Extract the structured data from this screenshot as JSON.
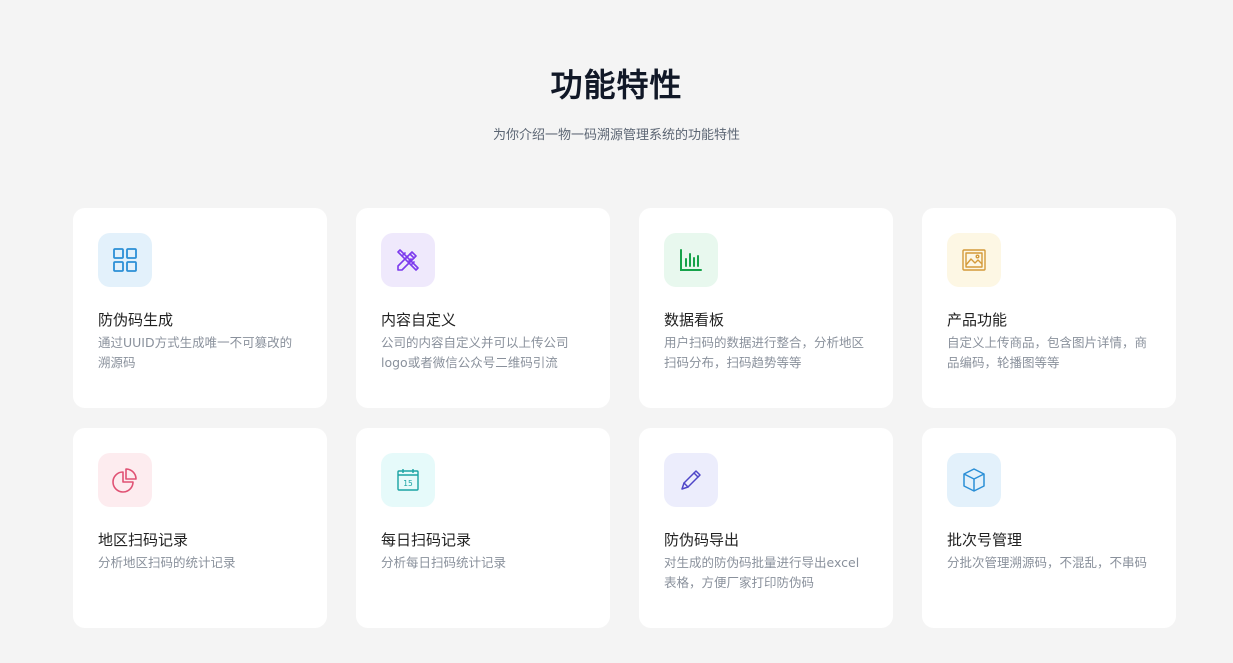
{
  "section": {
    "title": "功能特性",
    "subtitle": "为你介绍一物一码溯源管理系统的功能特性"
  },
  "features": [
    {
      "title": "防伪码生成",
      "desc": "通过UUID方式生成唯一不可篡改的溯源码",
      "icon": "grid-icon",
      "bg": "#e3f1fb",
      "color": "#2b8fd6"
    },
    {
      "title": "内容自定义",
      "desc": "公司的内容自定义并可以上传公司logo或者微信公众号二维码引流",
      "icon": "pencil-ruler-icon",
      "bg": "#efe9fc",
      "color": "#7c3aed"
    },
    {
      "title": "数据看板",
      "desc": "用户扫码的数据进行整合，分析地区扫码分布，扫码趋势等等",
      "icon": "bar-chart-icon",
      "bg": "#e8f8ee",
      "color": "#16a34a"
    },
    {
      "title": "产品功能",
      "desc": "自定义上传商品，包含图片详情，商品编码，轮播图等等",
      "icon": "image-icon",
      "bg": "#fdf7e4",
      "color": "#d49a3a"
    },
    {
      "title": "地区扫码记录",
      "desc": "分析地区扫码的统计记录",
      "icon": "pie-chart-icon",
      "bg": "#fdecef",
      "color": "#e05274"
    },
    {
      "title": "每日扫码记录",
      "desc": "分析每日扫码统计记录",
      "icon": "calendar-icon",
      "bg": "#e6fafa",
      "color": "#1aa3a3",
      "calendar_day": "15"
    },
    {
      "title": "防伪码导出",
      "desc": "对生成的防伪码批量进行导出excel表格，方便厂家打印防伪码",
      "icon": "pen-icon",
      "bg": "#ecedfc",
      "color": "#4f46c8"
    },
    {
      "title": "批次号管理",
      "desc": "分批次管理溯源码，不混乱，不串码",
      "icon": "cube-icon",
      "bg": "#e3f1fb",
      "color": "#2b8fd6"
    }
  ]
}
